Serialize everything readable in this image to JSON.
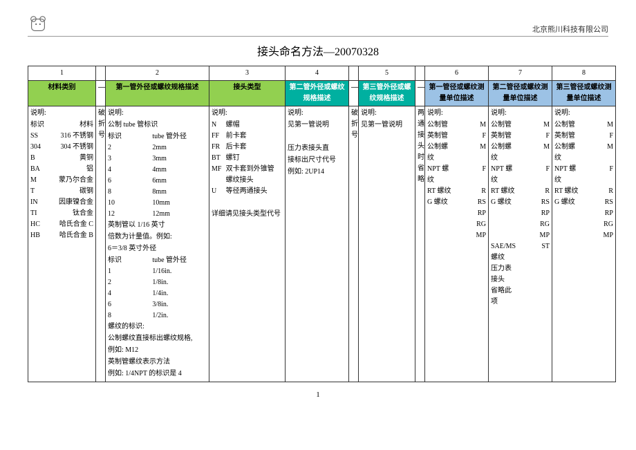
{
  "company": "北京熊川科技有限公司",
  "title": "接头命名方法—20070328",
  "pageNumber": "1",
  "colNums": [
    "1",
    "2",
    "3",
    "4",
    "5",
    "6",
    "7",
    "8"
  ],
  "dash": "—",
  "headers": {
    "h1": "材料类别",
    "h2": "第一管外径或螺纹规格描述",
    "h3": "接头类型",
    "h4": "第二管外径或螺纹规格描述",
    "h5": "第三管外径或螺纹规格描述",
    "h6": "第一管径或螺纹测量单位描述",
    "h7": "第二管径或螺纹测量单位描述",
    "h8": "第三管径或螺纹测量单位描述"
  },
  "narrowA": "破折号",
  "narrowB": "破折号",
  "narrowC": "两通接头时省略",
  "col1": {
    "t": "说明:",
    "pairs": [
      [
        "标识",
        "材料"
      ],
      [
        "SS",
        "316 不锈钢"
      ],
      [
        "304",
        "304 不锈钢"
      ],
      [
        "B",
        "黄铜"
      ],
      [
        "BA",
        "铝"
      ],
      [
        "M",
        "蒙乃尔合金"
      ],
      [
        "T",
        "碳钢"
      ],
      [
        "IN",
        "因康镍合金"
      ],
      [
        "TI",
        "钛合金"
      ],
      [
        "HC",
        "哈氏合金 C"
      ],
      [
        "HB",
        "哈氏合金 B"
      ]
    ]
  },
  "col2": {
    "t": "说明:",
    "l1": "公制 tube 管标识",
    "pairs1": [
      [
        "标识",
        "tube 管外径"
      ],
      [
        "2",
        "2mm"
      ],
      [
        "3",
        "3mm"
      ],
      [
        "4",
        "4mm"
      ],
      [
        "6",
        "6mm"
      ],
      [
        "8",
        "8mm"
      ],
      [
        "10",
        "10mm"
      ],
      [
        "12",
        "12mm"
      ]
    ],
    "l2": "英制管以 1/16 英寸",
    "l3": "倍数为计量值。例如:",
    "l4": "6＝3/8 英寸外径",
    "pairs2": [
      [
        "标识",
        "tube 管外径"
      ],
      [
        "1",
        "1/16in."
      ],
      [
        "2",
        "1/8in."
      ],
      [
        "4",
        "1/4in."
      ],
      [
        "6",
        "3/8in."
      ],
      [
        "8",
        "1/2in."
      ]
    ],
    "l5": "螺纹的标识:",
    "l6": "公制螺纹直接标出螺纹规格,",
    "l7": "例如: M12",
    "l8": "英制管螺纹表示方法",
    "l9": "例如: 1/4NPT 的标识是 4"
  },
  "col3": {
    "t": "说明:",
    "pairs": [
      [
        "N",
        "螺帽"
      ],
      [
        "FF",
        "前卡套"
      ],
      [
        "FR",
        "后卡套"
      ],
      [
        "BT",
        "螺钉"
      ],
      [
        "MF",
        "双卡套到外锥管"
      ],
      [
        "",
        "螺纹接头"
      ],
      [
        "U",
        "等径两通接头"
      ]
    ],
    "extra": "详细请见接头类型代号"
  },
  "col4": {
    "t": "说明:",
    "lines": [
      "见第一管说明",
      "",
      "压力表接头直",
      "接标出尺寸代号",
      "例如: 2UP14"
    ]
  },
  "col5": {
    "t": "说明:",
    "lines": [
      "见第一管说明"
    ]
  },
  "col6": {
    "t": "说明:",
    "pairs": [
      [
        "公制管",
        "M"
      ],
      [
        "英制管",
        "F"
      ],
      [
        "公制螺纹",
        "M"
      ],
      [
        "NPT 螺纹",
        "F"
      ],
      [
        "RT 螺纹",
        "R"
      ],
      [
        "G 螺纹",
        "RS"
      ],
      [
        "",
        "RP"
      ],
      [
        "",
        "RG"
      ],
      [
        "",
        "MP"
      ]
    ]
  },
  "col7": {
    "t": "说明:",
    "pairs": [
      [
        "公制管",
        "M"
      ],
      [
        "英制管",
        "F"
      ],
      [
        "公制螺纹",
        "M"
      ],
      [
        "NPT 螺纹",
        "F"
      ],
      [
        "RT 螺纹",
        "R"
      ],
      [
        "G 螺纹",
        "RS"
      ],
      [
        "",
        "RP"
      ],
      [
        "",
        "RG"
      ],
      [
        "",
        "MP"
      ],
      [
        "SAE/MS 螺纹",
        "ST"
      ],
      [
        "",
        ""
      ],
      [
        "压力表接头",
        ""
      ],
      [
        "省略此项",
        ""
      ]
    ]
  },
  "col8": {
    "t": "说明:",
    "pairs": [
      [
        "公制管",
        "M"
      ],
      [
        "英制管",
        "F"
      ],
      [
        "公制螺纹",
        "M"
      ],
      [
        "NPT 螺纹",
        "F"
      ],
      [
        "RT 螺纹",
        "R"
      ],
      [
        "G 螺纹",
        "RS"
      ],
      [
        "",
        "RP"
      ],
      [
        "",
        "RG"
      ],
      [
        "",
        "MP"
      ]
    ]
  }
}
